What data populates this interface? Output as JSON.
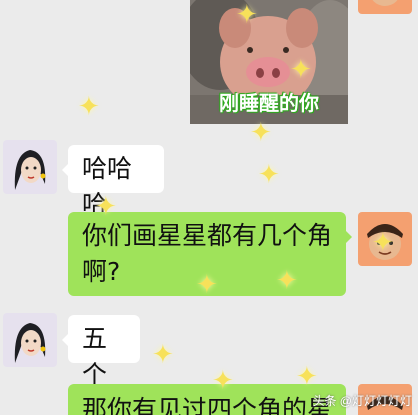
{
  "colors": {
    "background": "#ebebeb",
    "bubble_left": "#ffffff",
    "bubble_right": "#9fe35a",
    "sparkle": "#f7e15a"
  },
  "sticker": {
    "caption": "刚睡醒的你"
  },
  "messages": [
    {
      "side": "left",
      "text": "哈哈哈"
    },
    {
      "side": "right",
      "line1": "你们画星星都有几个角",
      "line2": "啊?"
    },
    {
      "side": "left",
      "text": "五个"
    },
    {
      "side": "right",
      "text": "那你有见过四个角的星"
    }
  ],
  "watermark": "头条 @灯灯灯灯灯"
}
